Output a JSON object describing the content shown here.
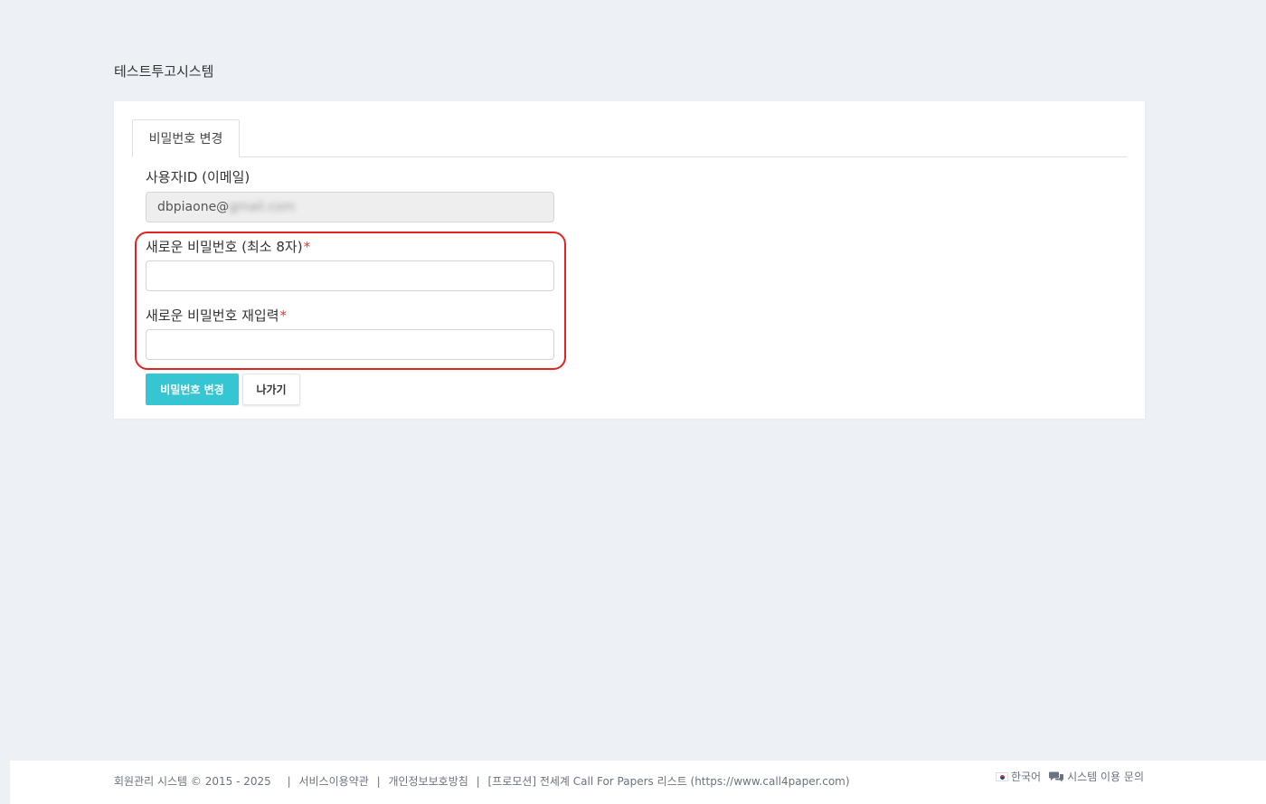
{
  "app": {
    "title": "테스트투고시스템"
  },
  "tabs": [
    {
      "label": "비밀번호 변경"
    }
  ],
  "form": {
    "user_id_label": "사용자ID (이메일)",
    "user_id_value": "dbpiaone@",
    "user_id_blurred": "gmail.com",
    "new_password_label": "새로운 비밀번호 (최소 8자)",
    "new_password_value": "",
    "confirm_password_label": "새로운 비밀번호 재입력",
    "confirm_password_value": "",
    "required_mark": "*"
  },
  "buttons": {
    "change_password": "비밀번호 변경",
    "exit": "나가기"
  },
  "footer": {
    "copyright": "회원관리 시스템 © 2015 - 2025",
    "links": [
      "서비스이용약관",
      "개인정보보호방침",
      "[프로모션] 전세계 Call For Papers 리스트 (https://www.call4paper.com)"
    ],
    "separator": "|",
    "language": "한국어",
    "contact": "시스템 이용 문의"
  },
  "colors": {
    "primary": "#36c6d3",
    "highlight": "#e02424",
    "required": "#e53935",
    "background": "#edf1f5"
  }
}
